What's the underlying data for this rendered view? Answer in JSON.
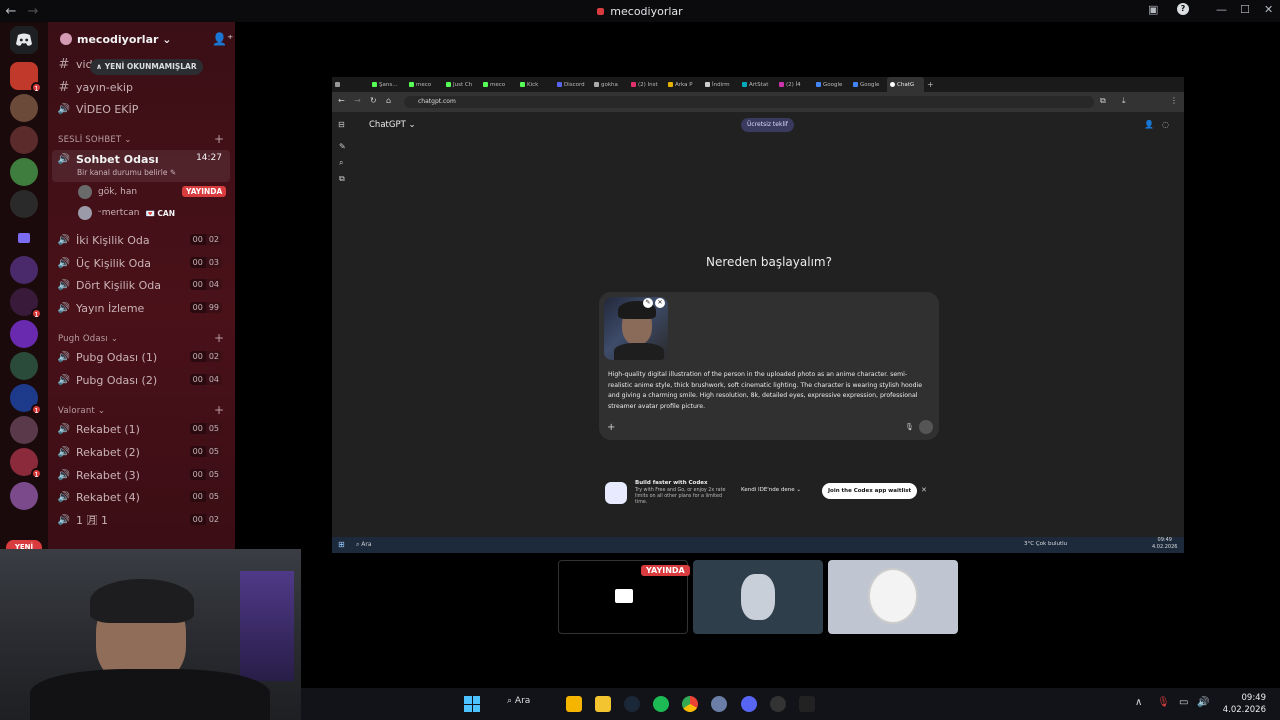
{
  "titlebar": {
    "title": "mecodiyorlar"
  },
  "rail": {
    "badges": [
      "1",
      "1",
      "1",
      "1",
      "1"
    ],
    "new_pill": "YENİ"
  },
  "guild": {
    "name": "mecodiyorlar ⌄"
  },
  "tooltip": {
    "unread": "∧ YENİ OKUNMAMIŞLAR"
  },
  "text_channels": [
    "vid",
    "yayın-ekip",
    "VİDEO EKİP"
  ],
  "categories": {
    "sesli": "SESLİ SOHBET",
    "pugh": "Pugh Odası",
    "valorant": "Valorant"
  },
  "sohbet": {
    "name": "Sohbet Odası",
    "time": "14:27",
    "status": "Bir kanal durumu belirle ✎"
  },
  "voice_users": [
    {
      "name": "gök, han",
      "badge": "YAYINDA"
    },
    {
      "name": "ᵕmertcan",
      "badge": "💌 CAN"
    }
  ],
  "voice_channels": [
    {
      "name": "İki Kişilik Oda",
      "a": "00",
      "b": "02"
    },
    {
      "name": "Üç Kişilik Oda",
      "a": "00",
      "b": "03"
    },
    {
      "name": "Dört Kişilik Oda",
      "a": "00",
      "b": "04"
    },
    {
      "name": "Yayın İzleme",
      "a": "00",
      "b": "99"
    }
  ],
  "pugh_channels": [
    {
      "name": "Pubg Odası (1)",
      "a": "00",
      "b": "02"
    },
    {
      "name": "Pubg Odası (2)",
      "a": "00",
      "b": "04"
    }
  ],
  "valorant_channels": [
    {
      "name": "Rekabet (1)",
      "a": "00",
      "b": "05"
    },
    {
      "name": "Rekabet (2)",
      "a": "00",
      "b": "05"
    },
    {
      "name": "Rekabet (3)",
      "a": "00",
      "b": "05"
    },
    {
      "name": "Rekabet (4)",
      "a": "00",
      "b": "05"
    },
    {
      "name": "1 🈷 1",
      "a": "00",
      "b": "02"
    }
  ],
  "browser": {
    "tabs": [
      "Şans...",
      "meco",
      "Just Ch",
      "meco",
      "Kick",
      "Discord",
      "gokha",
      "(2) Inst",
      "Arka P",
      "İndirm",
      "ArtStat",
      "(2) İ4",
      "Google",
      "Google",
      "ChatG"
    ],
    "url": "chatgpt.com"
  },
  "chatgpt": {
    "title": "ChatGPT ⌄",
    "free_offer": "Ücretsiz teklif",
    "headline": "Nereden başlayalım?",
    "prompt": "High-quality digital illustration of the person in the uploaded photo as an anime character. semi-realistic anime style, thick brushwork, soft cinematic lighting. The character is wearing stylish hoodie and giving a charming smile. High resolution, 8k, detailed eyes, expressive expression, professional streamer avatar profile picture.",
    "codex_title": "Build faster with Codex",
    "codex_desc": "Try with Free and Go, or enjoy 2x rate limits on all other plans for a limited time.",
    "ide_button": "Kendi IDE'nde dene ⌄",
    "join_button": "Join the Codex app waitlist"
  },
  "inner_taskbar": {
    "search": "Ara",
    "weather": "3°C Çok bulutlu",
    "time": "09:49",
    "date": "4.02.2026"
  },
  "stream": {
    "live": "YAYINDA"
  },
  "taskbar": {
    "search": "Ara",
    "time": "09:49",
    "date": "4.02.2026"
  }
}
